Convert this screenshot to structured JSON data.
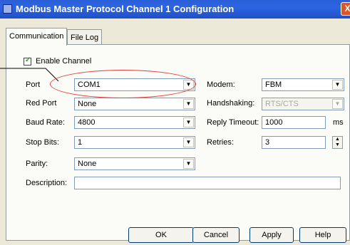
{
  "window": {
    "title": "Modbus Master Protocol Channel 1 Configuration",
    "close_glyph": "X"
  },
  "tabs": [
    {
      "label": "Communication",
      "active": true
    },
    {
      "label": "File Log",
      "active": false
    }
  ],
  "enable_channel": {
    "label": "Enable Channel",
    "checked": true
  },
  "fields": {
    "port": {
      "label": "Port",
      "value": "COM1"
    },
    "red_port": {
      "label": "Red Port",
      "value": "None"
    },
    "baud_rate": {
      "label": "Baud Rate:",
      "value": "4800"
    },
    "stop_bits": {
      "label": "Stop Bits:",
      "value": "1"
    },
    "parity": {
      "label": "Parity:",
      "value": "None"
    },
    "description": {
      "label": "Description:",
      "value": ""
    },
    "modem": {
      "label": "Modem:",
      "value": "FBM"
    },
    "handshaking": {
      "label": "Handshaking:",
      "value": "RTS/CTS"
    },
    "reply_timeout": {
      "label": "Reply Timeout:",
      "value": "1000",
      "unit": "ms"
    },
    "retries": {
      "label": "Retries:",
      "value": "3"
    }
  },
  "buttons": {
    "ok": "OK",
    "cancel": "Cancel",
    "apply": "Apply",
    "help": "Help"
  },
  "annotation": {
    "color": "#e04040"
  }
}
